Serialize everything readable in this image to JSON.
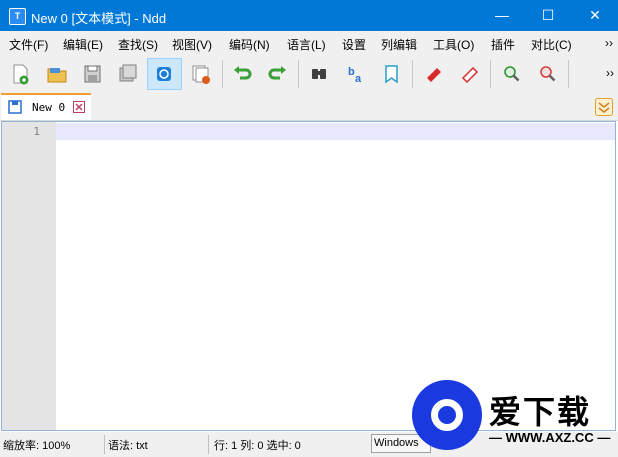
{
  "window": {
    "title": "New 0 [文本模式] - Ndd",
    "app_icon": "T",
    "minimize_glyph": "—",
    "maximize_glyph": "☐",
    "close_glyph": "✕"
  },
  "menubar": {
    "items": [
      "文件(F)",
      "编辑(E)",
      "查找(S)",
      "视图(V)",
      "编码(N)",
      "语言(L)",
      "设置",
      "列编辑",
      "工具(O)",
      "插件",
      "对比(C)"
    ],
    "overflow": "››"
  },
  "toolbar": {
    "buttons": [
      {
        "icon": "new-file-icon",
        "color": "#3a9a3a"
      },
      {
        "icon": "open-folder-icon",
        "color": "#e0a020"
      },
      {
        "icon": "save-icon",
        "color": "#707070"
      },
      {
        "icon": "save-all-icon",
        "color": "#707070"
      },
      {
        "icon": "auto-save-icon",
        "color": "#1f7fd8"
      },
      {
        "icon": "close-file-icon",
        "color": "#e05a1a"
      },
      {
        "icon": "undo-icon",
        "color": "#3aa03a"
      },
      {
        "icon": "redo-icon",
        "color": "#3aa03a"
      },
      {
        "icon": "find-icon",
        "color": "#404040"
      },
      {
        "icon": "replace-icon",
        "color": "#2a6fd0"
      },
      {
        "icon": "bookmark-icon",
        "color": "#2aa0c8"
      },
      {
        "icon": "marker-icon",
        "color": "#d82a2a"
      },
      {
        "icon": "eraser-icon",
        "color": "#d82a2a"
      },
      {
        "icon": "zoom-in-icon",
        "color": "#2a8f2a"
      },
      {
        "icon": "zoom-out-icon",
        "color": "#d83a3a"
      }
    ],
    "overflow": "››"
  },
  "tabs": [
    {
      "label": "New 0",
      "active": true
    }
  ],
  "editor": {
    "line_numbers": [
      "1"
    ]
  },
  "statusbar": {
    "zoom": "缩放率: 100%",
    "syntax": "语法: txt",
    "position": "行: 1 列: 0 选中: 0",
    "line_ending": "Windows"
  },
  "watermark": {
    "brand": "爱下载",
    "url": "— WWW.AXZ.CC —"
  }
}
